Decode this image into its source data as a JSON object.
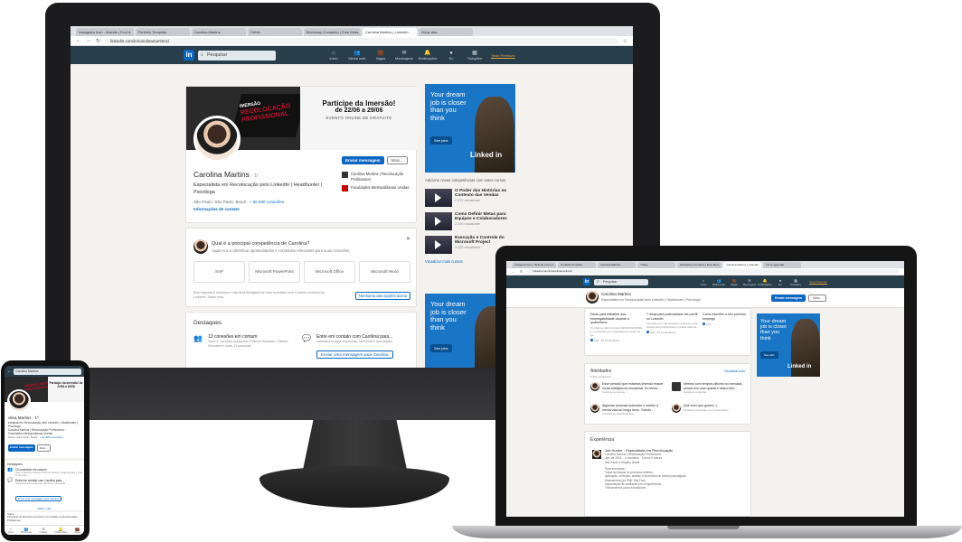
{
  "desktop": {
    "tabs": [
      "Instagram Icon - Brands | Font A",
      "Portfolio Template",
      "Carolina Martins",
      "Treble",
      "Workshop Completo | Free Meta",
      "Carolina Martins | LinkedIn",
      "Nova aba",
      "Nova aguardar"
    ],
    "url": "linkedin.com/in/carolinamartins1/",
    "search_placeholder": "Pesquisar",
    "nav": [
      {
        "icon": "home-icon",
        "glyph": "⌂",
        "label": "Início"
      },
      {
        "icon": "network-icon",
        "glyph": "👥",
        "label": "Minha rede"
      },
      {
        "icon": "jobs-icon",
        "glyph": "💼",
        "label": "Vagas"
      },
      {
        "icon": "messages-icon",
        "glyph": "✉",
        "label": "Mensagens"
      },
      {
        "icon": "notifications-icon",
        "glyph": "🔔",
        "label": "Notificações"
      },
      {
        "icon": "me-icon",
        "glyph": "●",
        "label": "Eu"
      },
      {
        "icon": "apps-icon",
        "glyph": "▦",
        "label": "Soluções"
      }
    ],
    "premium_label": "Teste Premium",
    "banner": {
      "left_line1": "IMERSÃO",
      "left_line2": "RECOLOCAÇÃO",
      "left_line3": "PROFISSIONAL",
      "title": "Participe da Imersão!",
      "dates": "de 22/06 a 29/06",
      "subtitle": "EVENTO ONLINE DE GRATUITO"
    },
    "profile": {
      "send_message": "Enviar mensagem",
      "more": "Mais...",
      "name": "Carolina Martins",
      "degree": "· 1º",
      "headline": "Especialista em Recolocação pelo LinkedIn | Headhunter | Psicóloga",
      "location": "São Paulo, São Paulo, Brasil ·",
      "connections": "+ de 500 conexões",
      "contact": "Informações de contato",
      "right_items": [
        "Carolina Martins | Recolocação Profissional",
        "Faculdades Metropolitanas Unidas"
      ]
    },
    "skill": {
      "question": "Qual é a principal competência de Carolina?",
      "sub": "Ajude-nos a identificar oportunidades e conteúdos relevantes para suas conexões",
      "options": [
        "SAP",
        "Microsoft PowerPoint",
        "Microsoft Office",
        "Microsoft Word"
      ],
      "footer": "Sua resposta é anônima e não será divulgada às suas conexões nem a outros usuários do LinkedIn. Saiba mais",
      "none": "Nenhuma das opções acima"
    },
    "destaques": {
      "title": "Destaques",
      "c1_title": "13 conexões em comum",
      "c1_desc": "Você e Carolina conhecem Patrício Antunes, Gabriel Schuster e mais 11 pessoas",
      "c2_title": "Entre em contato com Carolina para...",
      "c2_desc": "Assessoria para empresas, Mentoria e orientação.",
      "c2_button": "Enviar uma mensagem para Carolina"
    },
    "ad": {
      "line1": "Your dream",
      "line2": "job is closer",
      "line3": "than you",
      "line4": "think",
      "pill": "See jobs",
      "brand": "Linked in"
    },
    "courses_lead": "Adicione novas competências com estes cursos",
    "courses": [
      {
        "title": "O Poder das Histórias no Contexto das Vendas",
        "views": "2.472 visualizam"
      },
      {
        "title": "Como Definir Metas para Equipes e Colaboradores",
        "views": "2.228 visualizam"
      },
      {
        "title": "Execução e Controle do Microsoft Project",
        "views": "2.426 visualizam"
      }
    ],
    "courses_more": "Visualizar mais cursos"
  },
  "laptop": {
    "tabs": [
      "Instagram Icon - Brands | Font A",
      "Portfolio Template",
      "Carolina Martins",
      "Treble",
      "Workshop Completo | Free Meta",
      "Carolina Martins | LinkedIn",
      "Nova aguardar"
    ],
    "url": "linkedin.com/in/carolinamartins1/",
    "search_placeholder": "Pesquisar",
    "nav_labels": [
      "Início",
      "Minha rede",
      "Vagas",
      "Mensagens",
      "Notificações",
      "Eu",
      "Soluções"
    ],
    "premium_label": "Teste Premium",
    "sticky_name": "Carolina Martins",
    "sticky_headline": "Especialista em Recolocação pelo LinkedIn | Headhunter | Psicóloga",
    "send_message": "Enviar mensagem",
    "more": "Mais...",
    "posts": [
      {
        "title": "Dicas para trabalhar sua empregabilidade durante a quarentena",
        "snippet": "Os últimos dias têm sido DESAFIADORES, e o potencial sem a ameaça do Covid-19 foi...",
        "reactions": "128 · 36 comentários"
      },
      {
        "title": "7 dicas para potencializar seu perfil no LinkedIn",
        "snippet": "Lançado em mais diversos nomes de rede social para profissionais e possui mais de...",
        "reactions": "185 · 53 comentários"
      },
      {
        "title": "Como escolher o seu próximo emprego",
        "snippet": "",
        "reactions": "115"
      }
    ],
    "ad": {
      "line1": "Your dream",
      "line2": "job is closer",
      "line3": "than you",
      "line4": "think",
      "pill": "See jobs",
      "brand": "Linked in"
    },
    "activity": {
      "title": "Atividades",
      "followers": "5.911 seguidores",
      "see_all": "Visualizar tudo",
      "items": [
        {
          "text": "Esse período que estamos vivendo requer muita inteligência emocional. Eu tenho...",
          "meta": "Carolina comentou"
        },
        {
          "text": "Mesmo com tempos difíceis no mercado, pensei em uma quarta e citano três...",
          "meta": "Carolina comentou"
        },
        {
          "text": "Algumas pessoas quiseram o mulher a minha vida ao longo deve. Trando ...",
          "meta": "Carolina compartilhou isso"
        },
        {
          "text": "Que bom que gostou :)",
          "meta": "Carolina respondeu a um comentário"
        }
      ]
    },
    "experience": {
      "title": "Experiência",
      "role": "Job Hunter - Especialista em Recolocação",
      "company": "Carolina Martins | Recolocação Profissional",
      "period": "Jan. de 2016 – o momento · 5 anos 6 meses",
      "location": "São Paulo e Região, Brasil",
      "desc": [
        "Para empresas:",
        "Todas as etapas do processo seletivo",
        "Aplicação, correção, análise e devolutiva de testes psicológicos",
        "Assessment (da PMK, Big Five)",
        "Implantação de avaliação por competências",
        "Treinamentos para recrutadores"
      ]
    }
  },
  "phone": {
    "search": "Carolina Martins",
    "banner_red": "IMERSÃO RECOLOCAÇÃO PROFISSIONAL",
    "banner_title": "Participe da Imersão! de 22/06 a 29/06",
    "name": "olina Martins · 1º",
    "headline": "ecialista em Recolocação pelo LinkedIn | Headhunter | Psicóloga",
    "headline2": "Carolina Martins | Recolocação Profissional · Faculdades Metropolitanas Unidas",
    "location": "Paulo, São Paulo, Brasil ·",
    "connections": "+ de 500 conexões",
    "send_message": "Enviar mensagem",
    "more": "Mais...",
    "dest_title": "Destaques",
    "c1_title": "13 conexões em comum",
    "c1_desc": "Você e Carolina conhecem Patrício Antunes, Diego Almeida e mais 11 pessoas",
    "c2_title": "Entre em contato com Carolina para...",
    "c2_desc": "Assessoria para empresas, Mentoria e orientação",
    "c2_button": "Envie uma mensagem para Carolina",
    "see_more": "Saber mais",
    "about_title": "Sobre",
    "about_text": "Psicóloga de Recursos Humanos com ênfase na Recolocação Profissional",
    "bottom": [
      {
        "icon": "home-icon",
        "glyph": "⌂",
        "label": "Início"
      },
      {
        "icon": "network-icon",
        "glyph": "👥",
        "label": "Minha rede"
      },
      {
        "icon": "post-icon",
        "glyph": "⊕",
        "label": "Publicar"
      },
      {
        "icon": "notifications-icon",
        "glyph": "🔔",
        "label": "Notificações"
      },
      {
        "icon": "jobs-icon",
        "glyph": "💼",
        "label": "Vagas"
      }
    ]
  }
}
